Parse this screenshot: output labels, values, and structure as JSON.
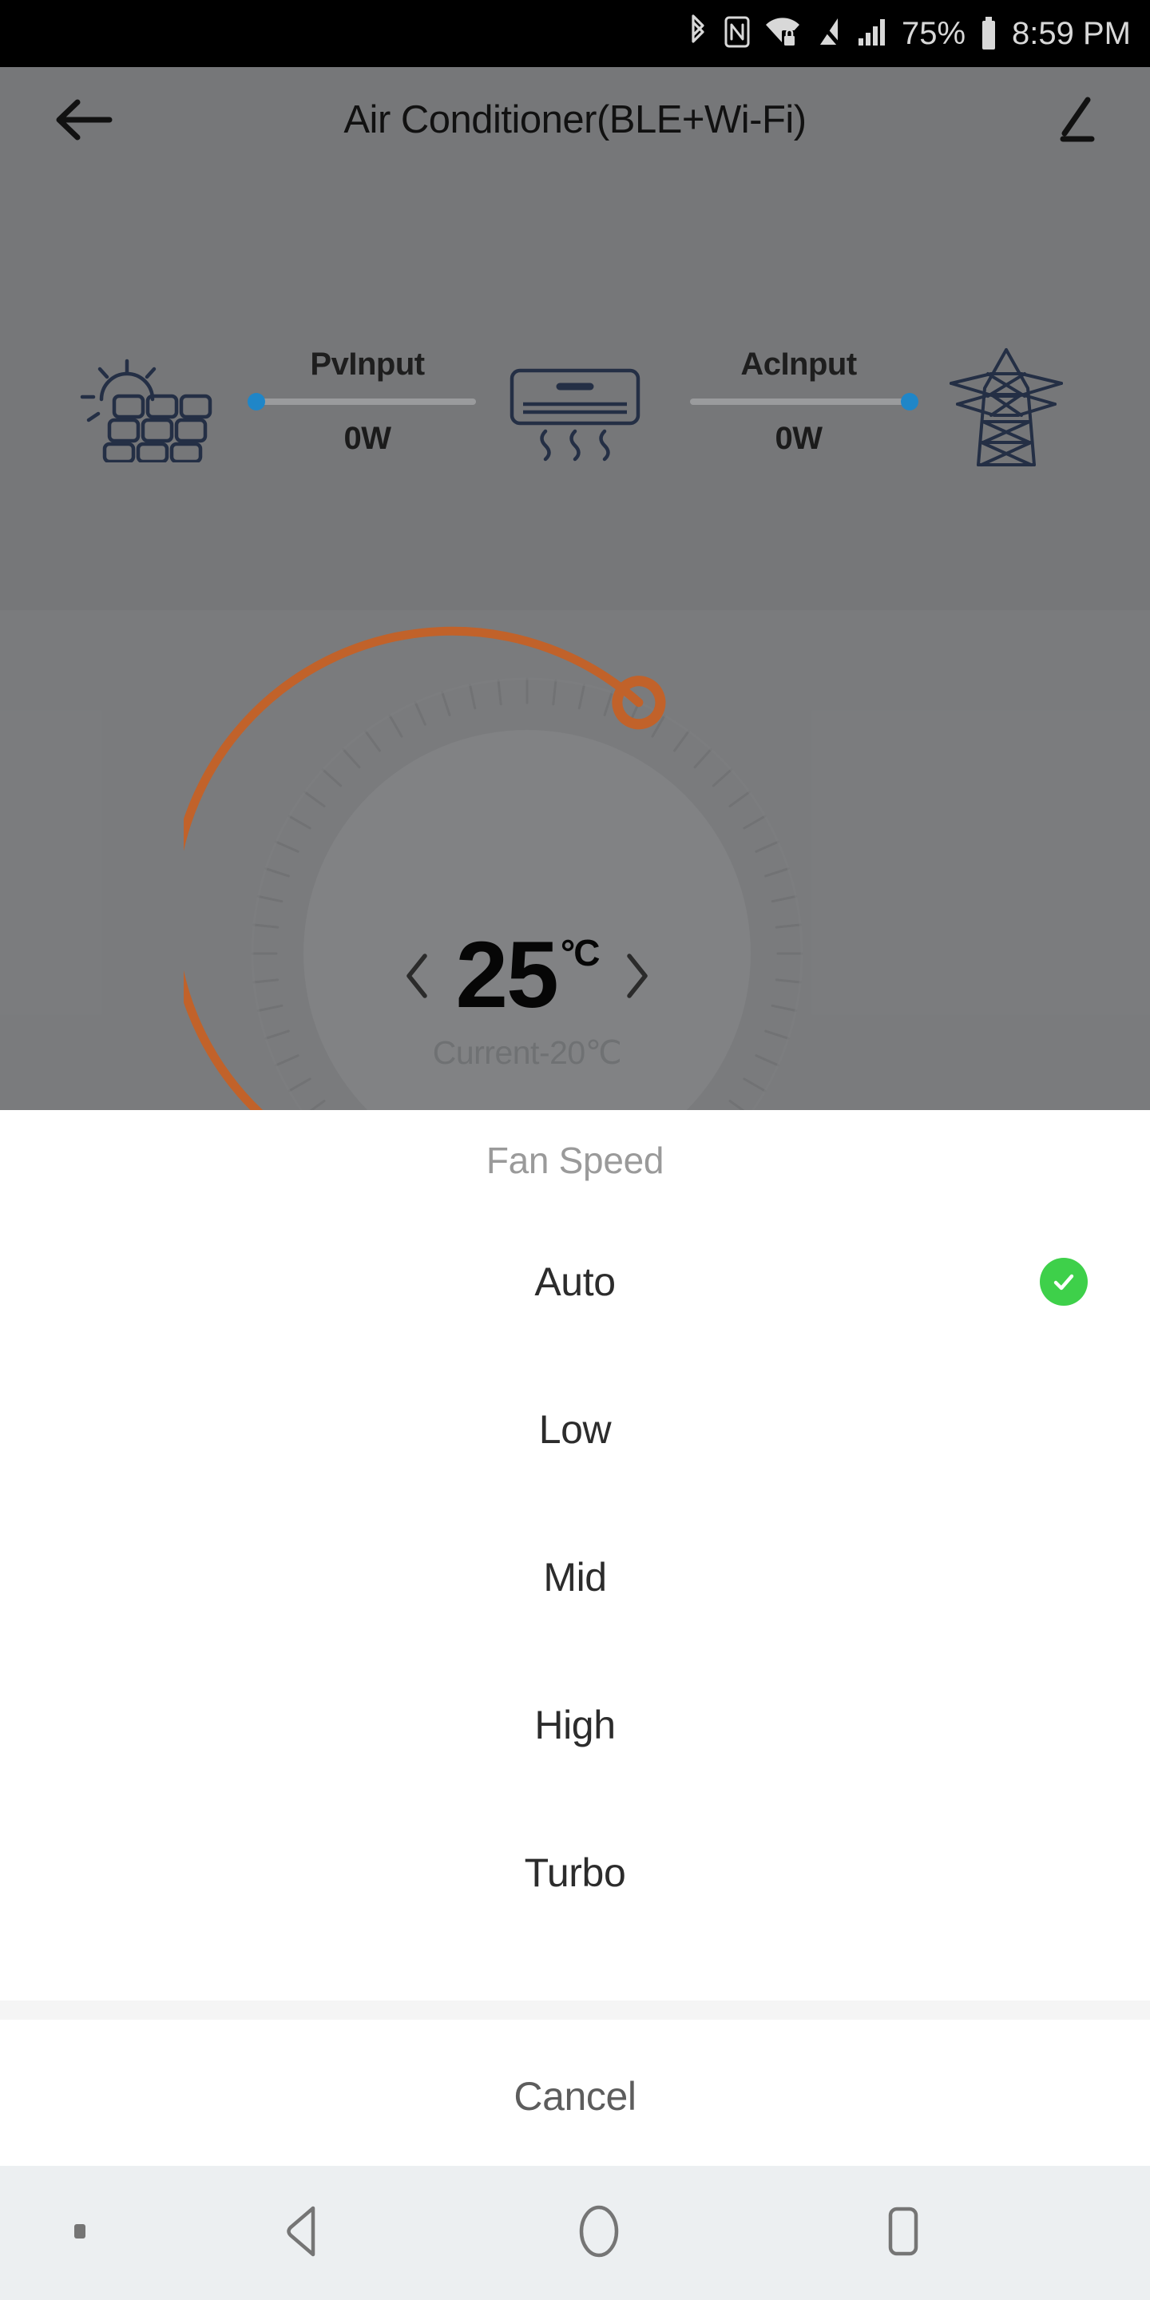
{
  "status_bar": {
    "battery_percent": "75%",
    "time": "8:59 PM",
    "icons": [
      "bluetooth-icon",
      "nfc-icon",
      "wifi-secure-icon",
      "signal-off-icon",
      "cellular-signal-icon",
      "battery-icon"
    ]
  },
  "app": {
    "title": "Air Conditioner(BLE+Wi-Fi)",
    "back_icon": "back-arrow-icon",
    "edit_icon": "pencil-edit-icon"
  },
  "power_flow": {
    "pv": {
      "icon": "solar-panel-icon",
      "label": "PvInput",
      "value": "0W",
      "dot_side": "left",
      "dot_color": "#1f86c8"
    },
    "device": {
      "icon": "air-conditioner-icon"
    },
    "ac": {
      "icon": "power-pylon-icon",
      "label": "AcInput",
      "value": "0W",
      "dot_side": "right",
      "dot_color": "#1f86c8"
    }
  },
  "thermostat": {
    "target_temp": "25",
    "unit": "°C",
    "current_label": "Current-20℃",
    "decrease_icon": "chevron-left-icon",
    "increase_icon": "chevron-right-icon",
    "arc_color": "#c1622a",
    "knob_color": "#c1622a"
  },
  "fan_speed_sheet": {
    "title": "Fan Speed",
    "selected": "Auto",
    "check_color": "#3ed04a",
    "options": [
      {
        "label": "Auto",
        "selected": true
      },
      {
        "label": "Low",
        "selected": false
      },
      {
        "label": "Mid",
        "selected": false
      },
      {
        "label": "High",
        "selected": false
      },
      {
        "label": "Turbo",
        "selected": false
      }
    ],
    "cancel_label": "Cancel"
  },
  "nav_bar": {
    "hide_icon": "hide-navbar-icon",
    "back_icon": "nav-back-triangle-icon",
    "home_icon": "nav-home-circle-icon",
    "recents_icon": "nav-recents-square-icon"
  }
}
